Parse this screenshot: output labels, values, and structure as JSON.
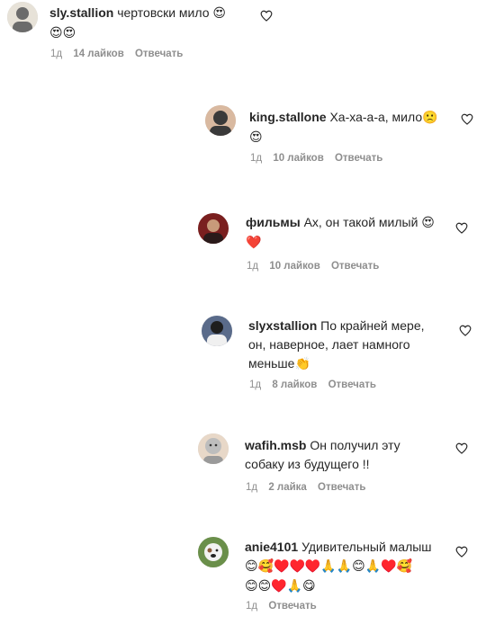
{
  "comments": [
    {
      "username": "sly.stallion",
      "text": "чертовски мило",
      "emoji_line1": "😍",
      "emoji_line2": "😍😍",
      "time": "1д",
      "likes": "14 лайков",
      "reply": "Отвечать",
      "avatar_colors": [
        "#6b6b6b",
        "#e7e2d8"
      ]
    }
  ],
  "replies": [
    {
      "username": "king.stallone",
      "text": "Ха-ха-а-а, мило",
      "emoji_inline": "🙁",
      "emoji_line2": "😍",
      "time": "1д",
      "likes": "10 лайков",
      "reply": "Отвечать",
      "avatar_colors": [
        "#3a3a3a",
        "#d9b9a0"
      ]
    },
    {
      "username": "фильмы",
      "text": "Ах, он такой милый",
      "emoji_inline": "😍",
      "emoji_line2": "❤️",
      "time": "1д",
      "likes": "10 лайков",
      "reply": "Отвечать",
      "avatar_colors": [
        "#7a1f1f",
        "#c89a7a"
      ]
    },
    {
      "username": "slyxstallion",
      "text_line1": "По крайней мере,",
      "text_line2": "он, наверное, лает намного",
      "text_line3": "меньше",
      "emoji_inline": "👏",
      "time": "1д",
      "likes": "8 лайков",
      "reply": "Отвечать",
      "avatar_colors": [
        "#5a6b8a",
        "#1e1e1e"
      ]
    },
    {
      "username": "wafih.msb",
      "text_line1": "Он получил эту",
      "text_line2": "собаку из будущего !!",
      "time": "1д",
      "likes": "2 лайка",
      "reply": "Отвечать",
      "avatar_colors": [
        "#bdbdbd",
        "#e8d8c8"
      ]
    },
    {
      "username": "anie4101",
      "text": "Удивительный малыш",
      "emoji_line2": "😊🥰♥️♥️♥️🙏🙏😊🙏♥️🥰",
      "emoji_line3": "😊😊♥️🙏😋",
      "time": "1д",
      "reply": "Отвечать",
      "avatar_colors": [
        "#6a8f4a",
        "#f2f2f2"
      ]
    }
  ],
  "accent": "#262626",
  "muted": "#8e8e8e"
}
